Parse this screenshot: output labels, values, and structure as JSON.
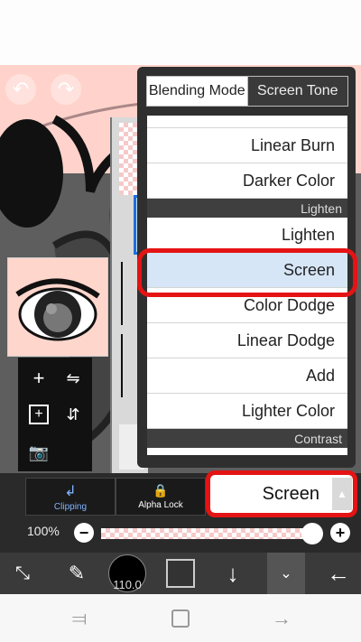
{
  "blend_menu": {
    "tabs": [
      "Blending Mode",
      "Screen Tone"
    ],
    "items": [
      {
        "label": "Linear Burn",
        "type": "item"
      },
      {
        "label": "Darker Color",
        "type": "item"
      },
      {
        "label": "Lighten",
        "type": "header"
      },
      {
        "label": "Lighten",
        "type": "item"
      },
      {
        "label": "Screen",
        "type": "item",
        "selected": true
      },
      {
        "label": "Color Dodge",
        "type": "item"
      },
      {
        "label": "Linear Dodge",
        "type": "item"
      },
      {
        "label": "Add",
        "type": "item"
      },
      {
        "label": "Lighter Color",
        "type": "item"
      },
      {
        "label": "Contrast",
        "type": "header"
      }
    ]
  },
  "layer_controls": {
    "clipping_label": "Clipping",
    "alpha_lock_label": "Alpha Lock",
    "blend_mode_value": "Screen",
    "opacity_label": "100%",
    "opacity_value": 100
  },
  "layer_list": {
    "opacity_partial": "100%"
  },
  "toolbar": {
    "brush_size": "110.0"
  },
  "colors": {
    "canvas_bg": "#ffd3cb",
    "highlight_red": "#e41414",
    "selected_row": "#d6e6f7",
    "clipping_accent": "#7fb5ff"
  },
  "icons": {
    "undo": "undo-icon",
    "redo": "redo-icon",
    "add_layer": "plus-icon",
    "flip_h": "flip-horizontal-icon",
    "add_layer_alt": "add-square-icon",
    "flip_v": "flip-vertical-icon",
    "camera": "camera-icon",
    "transform": "transform-icon",
    "brush": "brush-icon",
    "color": "color-swatch-icon",
    "down": "arrow-down-icon",
    "layers": "layers-icon",
    "back": "arrow-left-icon"
  }
}
